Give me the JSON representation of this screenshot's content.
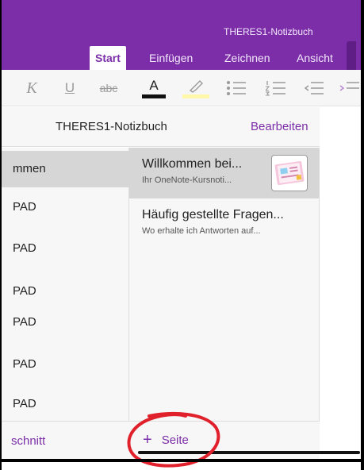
{
  "ribbon": {
    "notebook_title": "THERES1-Notizbuch",
    "tabs": [
      {
        "label": "Start",
        "active": true
      },
      {
        "label": "Einfügen",
        "active": false
      },
      {
        "label": "Zeichnen",
        "active": false
      },
      {
        "label": "Ansicht",
        "active": false
      }
    ]
  },
  "toolbar": {
    "italic": "K",
    "underline": "U",
    "strikethrough": "abc",
    "font_color": "A",
    "font_color_value": "#111111",
    "highlight_color_value": "#fff8a8",
    "icons": [
      "italic-icon",
      "underline-icon",
      "strikethrough-icon",
      "font-color-icon",
      "highlighter-icon",
      "bullet-list-icon",
      "numbered-list-icon",
      "outdent-icon",
      "indent-icon"
    ]
  },
  "notebook": {
    "title": "THERES1-Notizbuch",
    "edit_label": "Bearbeiten"
  },
  "sections": [
    {
      "label": "mmen",
      "selected": true
    },
    {
      "label": "PAD",
      "selected": false
    },
    {
      "label": "PAD",
      "selected": false
    },
    {
      "label": "PAD",
      "selected": false
    },
    {
      "label": "PAD",
      "selected": false
    },
    {
      "label": "PAD",
      "selected": false
    },
    {
      "label": "PAD",
      "selected": false
    }
  ],
  "pages": [
    {
      "title": "Willkommen bei...",
      "subtitle": "Ihr OneNote-Kursnoti...",
      "selected": true,
      "has_thumbnail": true
    },
    {
      "title": "Häufig gestellte Fragen...",
      "subtitle": "Wo erhalte ich Antworten auf...",
      "selected": false,
      "has_thumbnail": false
    }
  ],
  "bottom": {
    "section_label": "schnitt",
    "add_page_label": "Seite",
    "add_page_plus": "+"
  },
  "colors": {
    "accent": "#7b2ea8",
    "annotation": "#e0202a"
  }
}
